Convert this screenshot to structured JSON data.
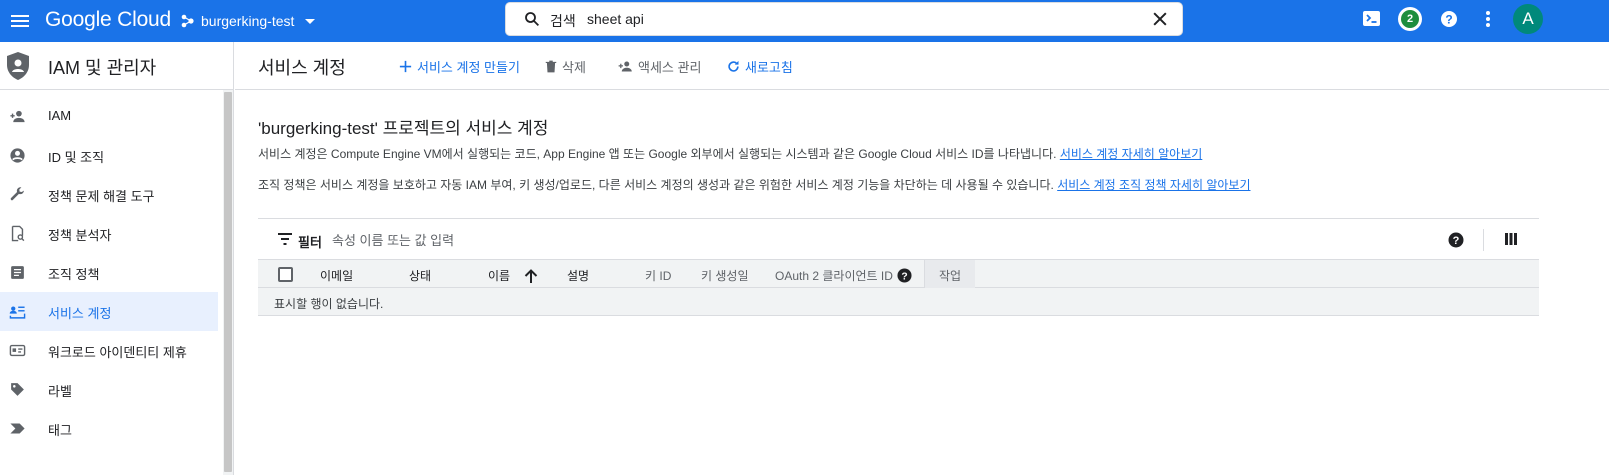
{
  "topbar": {
    "logo": "Google Cloud",
    "project": "burgerking-test",
    "search": {
      "label": "검색",
      "value": "sheet api"
    },
    "notification_count": "2",
    "avatar_letter": "A",
    "brand_color": "#1a73e8"
  },
  "sidebar": {
    "title": "IAM 및 관리자",
    "items": [
      {
        "label": "IAM",
        "icon": "person-add-icon"
      },
      {
        "label": "ID 및 조직",
        "icon": "account-circle-icon"
      },
      {
        "label": "정책 문제 해결 도구",
        "icon": "wrench-icon"
      },
      {
        "label": "정책 분석자",
        "icon": "policy-document-icon"
      },
      {
        "label": "조직 정책",
        "icon": "list-document-icon"
      },
      {
        "label": "서비스 계정",
        "icon": "service-account-icon",
        "active": true
      },
      {
        "label": "워크로드 아이덴티티 제휴",
        "icon": "id-card-icon"
      },
      {
        "label": "라벨",
        "icon": "label-icon"
      },
      {
        "label": "태그",
        "icon": "tag-arrow-icon"
      }
    ]
  },
  "header": {
    "title": "서비스 계정",
    "actions": {
      "create": "서비스 계정 만들기",
      "delete": "삭제",
      "manage_access": "액세스 관리",
      "refresh": "새로고침"
    }
  },
  "main": {
    "section_title": "'burgerking-test' 프로젝트의 서비스 계정",
    "desc1": "서비스 계정은 Compute Engine VM에서 실행되는 코드, App Engine 앱 또는 Google 외부에서 실행되는 시스템과 같은 Google Cloud 서비스 ID를 나타냅니다.",
    "desc1_link": "서비스 계정 자세히 알아보기",
    "desc2": "조직 정책은 서비스 계정을 보호하고 자동 IAM 부여, 키 생성/업로드, 다른 서비스 계정의 생성과 같은 위험한 서비스 계정 기능을 차단하는 데 사용될 수 있습니다.",
    "desc2_link": "서비스 계정 조직 정책 자세히 알아보기"
  },
  "table": {
    "filter_label": "필터",
    "filter_placeholder": "속성 이름 또는 값 입력",
    "columns": {
      "email": "이메일",
      "status": "상태",
      "name": "이름",
      "description": "설명",
      "key_id": "키 ID",
      "key_created": "키 생성일",
      "oauth_client_id": "OAuth 2 클라이언트 ID",
      "actions": "작업"
    },
    "empty_message": "표시할 행이 없습니다."
  }
}
